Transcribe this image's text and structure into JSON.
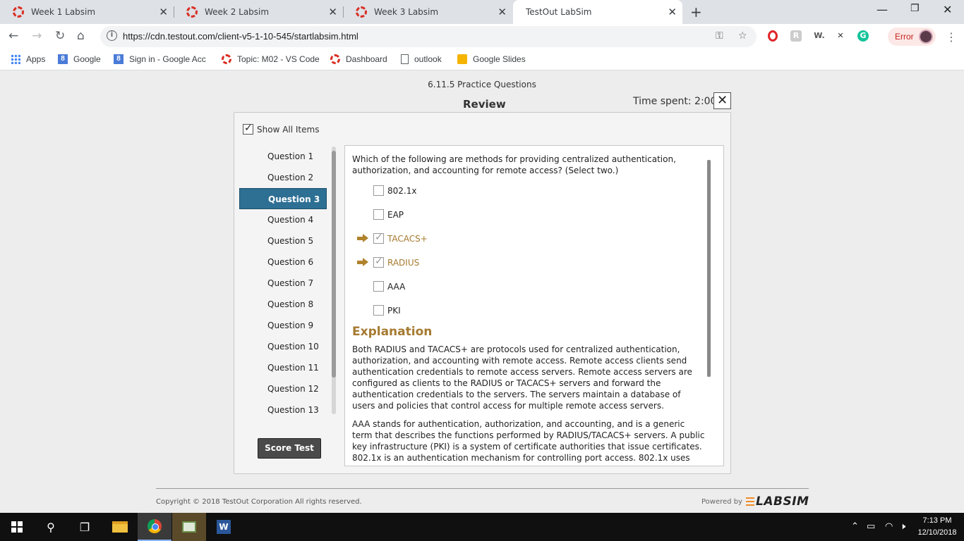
{
  "browser": {
    "tabs": [
      {
        "label": "Week 1 Labsim"
      },
      {
        "label": "Week 2 Labsim"
      },
      {
        "label": "Week 3 Labsim"
      },
      {
        "label": "TestOut LabSim"
      }
    ],
    "url": "https://cdn.testout.com/client-v5-1-10-545/startlabsim.html",
    "profile_status": "Error",
    "bookmarks": [
      {
        "label": "Apps",
        "icon": "apps-grid-icon"
      },
      {
        "label": "Google",
        "icon": "google-icon"
      },
      {
        "label": "Sign in - Google Acc",
        "icon": "google-icon"
      },
      {
        "label": "Topic: M02 - VS Code",
        "icon": "labsim-icon"
      },
      {
        "label": "Dashboard",
        "icon": "labsim-icon"
      },
      {
        "label": "outlook",
        "icon": "page-icon"
      },
      {
        "label": "Google Slides",
        "icon": "slides-icon"
      }
    ]
  },
  "page": {
    "title": "6.11.5 Practice Questions",
    "heading": "Review",
    "time_spent": "Time spent: 2:00",
    "show_all_label": "Show All Items",
    "questions": [
      "Question 1",
      "Question 2",
      "Question 3",
      "Question 4",
      "Question 5",
      "Question 6",
      "Question 7",
      "Question 8",
      "Question 9",
      "Question 10",
      "Question 11",
      "Question 12",
      "Question 13"
    ],
    "active_question": "Question 3",
    "score_button": "Score Test",
    "question_text": "Which of the following are methods for providing centralized authentication, authorization, and accounting for remote access? (Select two.)",
    "options": [
      {
        "label": "802.1x",
        "correct": false
      },
      {
        "label": "EAP",
        "correct": false
      },
      {
        "label": "TACACS+",
        "correct": true
      },
      {
        "label": "RADIUS",
        "correct": true
      },
      {
        "label": "AAA",
        "correct": false
      },
      {
        "label": "PKI",
        "correct": false
      }
    ],
    "explanation_heading": "Explanation",
    "explanation_p1": "Both RADIUS and TACACS+ are protocols used for centralized authentication, authorization, and accounting with remote access. Remote access clients send authentication credentials to remote access servers. Remote access servers are configured as clients to the RADIUS or TACACS+ servers and forward the authentication credentials to the servers. The servers maintain a database of users and policies that control access for multiple remote access servers.",
    "explanation_p2": "AAA stands for authentication, authorization, and accounting, and is a generic term that describes the functions performed by RADIUS/TACACS+ servers. A public key infrastructure (PKI) is a system of certificate authorities that issue certificates. 802.1x is an authentication mechanism for controlling port access. 802.1x uses",
    "copyright": "Copyright © 2018 TestOut Corporation All rights reserved.",
    "powered_by": "Powered by",
    "brand": "LABSIM"
  },
  "taskbar": {
    "time": "7:13 PM",
    "date": "12/10/2018"
  },
  "colors": {
    "active_question_bg": "#2e6f94",
    "correct_answer": "#a57a30"
  }
}
